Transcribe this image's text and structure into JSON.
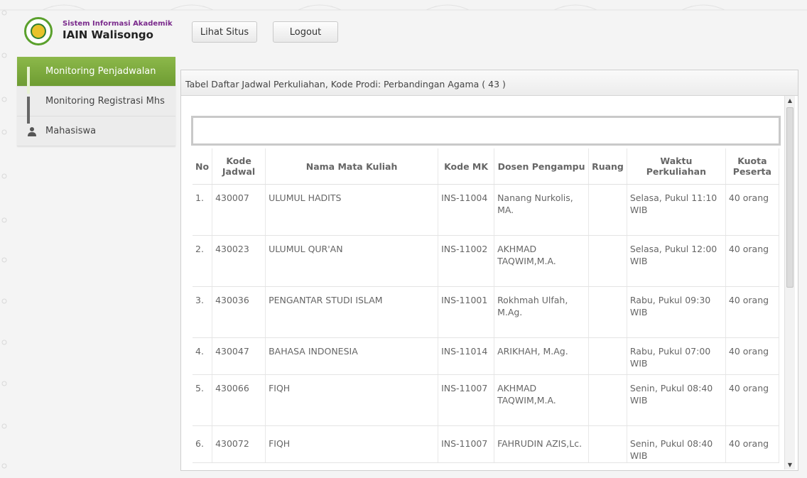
{
  "app": {
    "title_small": "Sistem Informasi Akademik",
    "title_main": "IAIN Walisongo"
  },
  "toolbar": {
    "view_site": "Lihat Situs",
    "logout": "Logout"
  },
  "sidebar": {
    "items": [
      {
        "label": "Monitoring Penjadwalan",
        "icon": "bar-chart-icon",
        "active": true
      },
      {
        "label": "Monitoring Registrasi Mhs",
        "icon": "bar-chart-icon",
        "active": false
      },
      {
        "label": "Mahasiswa",
        "icon": "user-icon",
        "active": false
      }
    ]
  },
  "panel": {
    "title": "Tabel Daftar Jadwal Perkuliahan, Kode Prodi: Perbandingan Agama ( 43 )"
  },
  "table": {
    "headers": {
      "no": "No",
      "kode_jadwal": "Kode Jadwal",
      "nama": "Nama Mata Kuliah",
      "kode_mk": "Kode MK",
      "dosen": "Dosen Pengampu",
      "ruang": "Ruang",
      "waktu": "Waktu Perkuliahan",
      "kuota": "Kuota Peserta"
    },
    "rows": [
      {
        "no": "1.",
        "kode_jadwal": "430007",
        "nama": "ULUMUL HADITS",
        "kode_mk": "INS-11004",
        "dosen": "Nanang Nurkolis, MA.",
        "ruang": "",
        "waktu": "Selasa, Pukul 11:10 WIB",
        "kuota": "40 orang"
      },
      {
        "no": "2.",
        "kode_jadwal": "430023",
        "nama": "ULUMUL QUR'AN",
        "kode_mk": "INS-11002",
        "dosen": "AKHMAD TAQWIM,M.A.",
        "ruang": "",
        "waktu": "Selasa, Pukul 12:00 WIB",
        "kuota": "40 orang"
      },
      {
        "no": "3.",
        "kode_jadwal": "430036",
        "nama": "PENGANTAR STUDI ISLAM",
        "kode_mk": "INS-11001",
        "dosen": "Rokhmah Ulfah, M.Ag.",
        "ruang": "",
        "waktu": "Rabu, Pukul 09:30 WIB",
        "kuota": "40 orang"
      },
      {
        "no": "4.",
        "kode_jadwal": "430047",
        "nama": "BAHASA INDONESIA",
        "kode_mk": "INS-11014",
        "dosen": "ARIKHAH, M.Ag.",
        "ruang": "",
        "waktu": "Rabu, Pukul 07:00 WIB",
        "kuota": "40 orang"
      },
      {
        "no": "5.",
        "kode_jadwal": "430066",
        "nama": "FIQH",
        "kode_mk": "INS-11007",
        "dosen": "AKHMAD TAQWIM,M.A.",
        "ruang": "",
        "waktu": "Senin, Pukul 08:40 WIB",
        "kuota": "40 orang"
      },
      {
        "no": "6.",
        "kode_jadwal": "430072",
        "nama": "FIQH",
        "kode_mk": "INS-11007",
        "dosen": "FAHRUDIN AZIS,Lc.",
        "ruang": "",
        "waktu": "Senin, Pukul 08:40 WIB",
        "kuota": "40 orang"
      }
    ]
  },
  "colors": {
    "active_nav": "#7aa83c",
    "brand_purple": "#7a2a8c"
  }
}
